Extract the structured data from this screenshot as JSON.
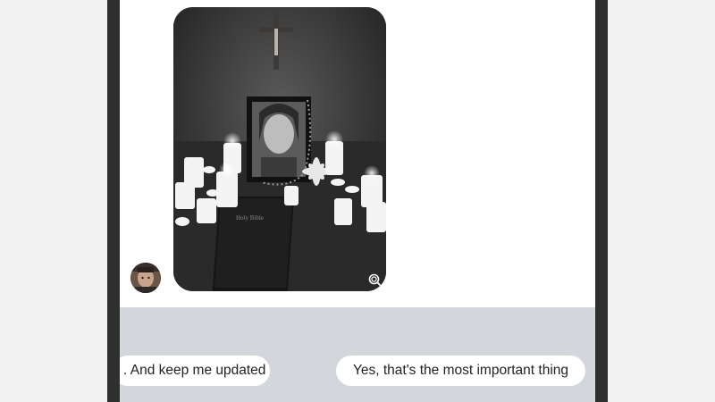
{
  "chat": {
    "image": {
      "alt": "memorial-altar-photo",
      "book_label": "Holy Bible"
    },
    "sender_avatar": "avatar-icon",
    "zoom_icon": "magnify-icon"
  },
  "quick_replies": [
    {
      "label": ". And keep me updated"
    },
    {
      "label": "Yes, that's the most important thing"
    }
  ],
  "colors": {
    "phone_frame": "#2f2f30",
    "background": "#f2f2f3",
    "quick_reply_bar": "#d3d7dc",
    "bubble": "#ffffff"
  }
}
